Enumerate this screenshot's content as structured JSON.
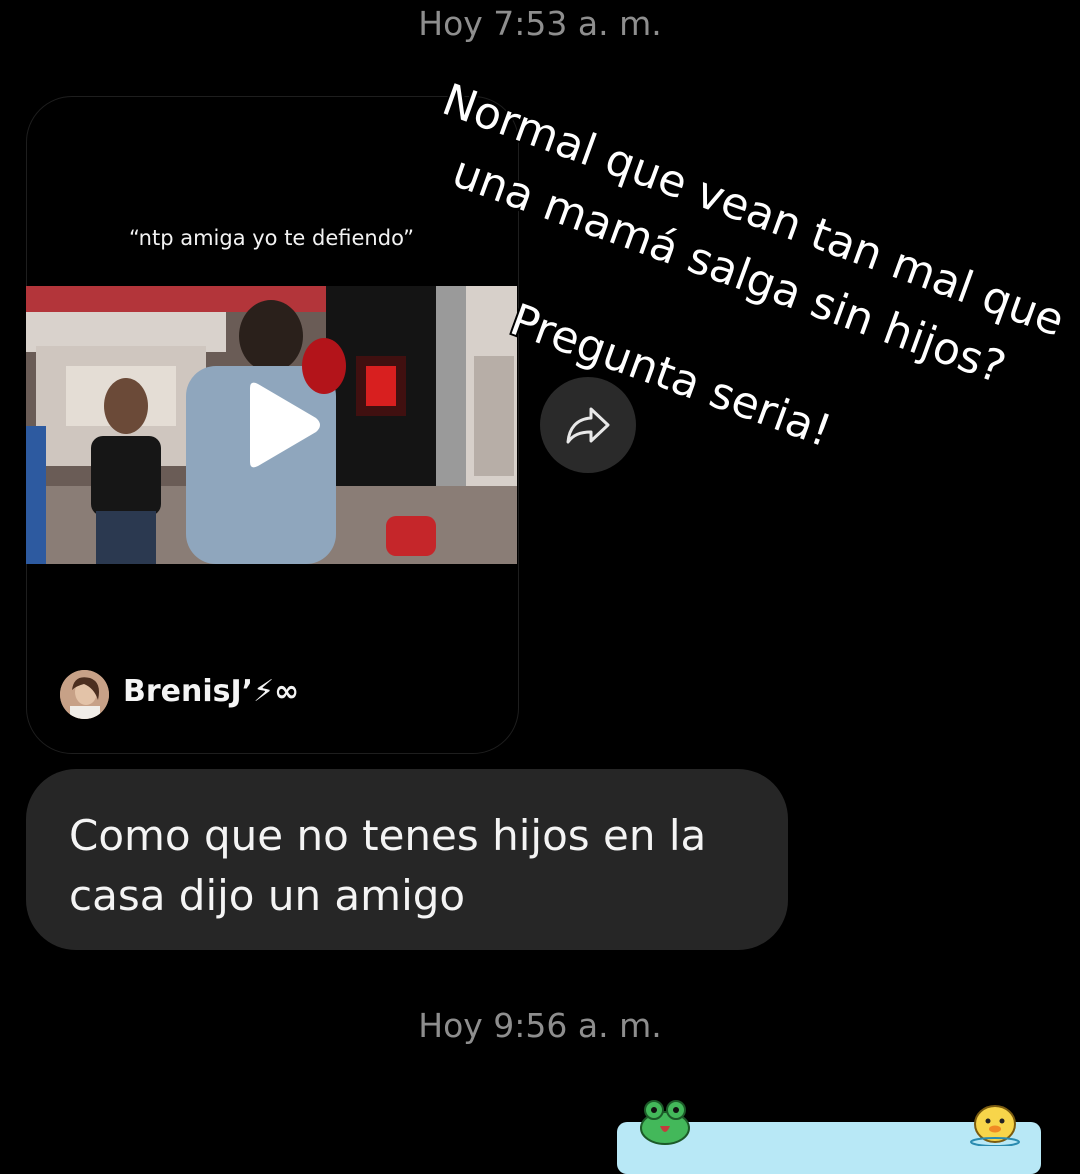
{
  "chat": {
    "timestamp_top": "Hoy 7:53 a. m.",
    "timestamp_bottom": "Hoy 9:56 a. m."
  },
  "shared_reel": {
    "caption": "“ntp amiga yo te defiendo”",
    "author": "BrenisJ’⚡∞"
  },
  "message": {
    "text": "Como que no tenes hijos en la casa dijo un amigo"
  },
  "overlay_text": {
    "line1": "Normal que vean tan mal que",
    "line2": "una mamá salga sin hijos?",
    "line3": "Pregunta seria!"
  },
  "colors": {
    "background": "#000000",
    "bubble": "#262626",
    "timestamp": "#8e8e8e",
    "sticker_pool": "#b8e8f6"
  },
  "icons": [
    "play-icon",
    "share-icon",
    "frog-sticker-icon",
    "duck-sticker-icon"
  ]
}
